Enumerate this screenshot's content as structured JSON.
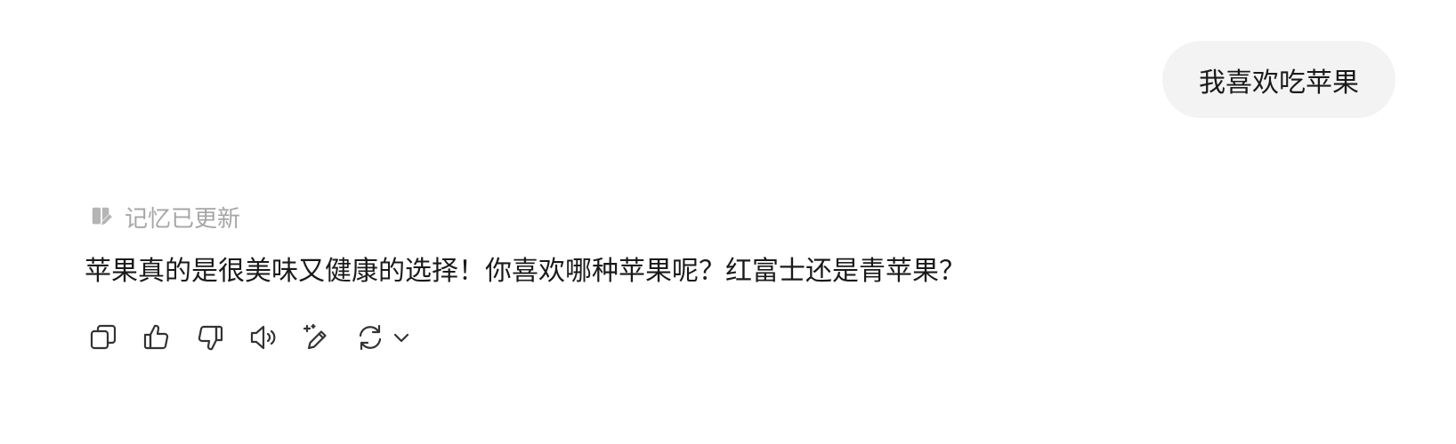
{
  "user_message": {
    "text": "我喜欢吃苹果"
  },
  "assistant": {
    "memory_status": {
      "icon": "memory-edit-icon",
      "label": "记忆已更新"
    },
    "reply": "苹果真的是很美味又健康的选择！你喜欢哪种苹果呢？红富士还是青苹果？",
    "actions": [
      {
        "name": "copy",
        "icon": "copy-icon"
      },
      {
        "name": "like",
        "icon": "thumbs-up-icon"
      },
      {
        "name": "dislike",
        "icon": "thumbs-down-icon"
      },
      {
        "name": "read-aloud",
        "icon": "speaker-icon"
      },
      {
        "name": "edit",
        "icon": "sparkle-pen-icon"
      },
      {
        "name": "regenerate",
        "icon": "refresh-icon"
      }
    ]
  },
  "colors": {
    "bubble_bg": "#f3f3f3",
    "text": "#1a1a1a",
    "muted": "#a6a6a6",
    "icon": "#333333"
  }
}
